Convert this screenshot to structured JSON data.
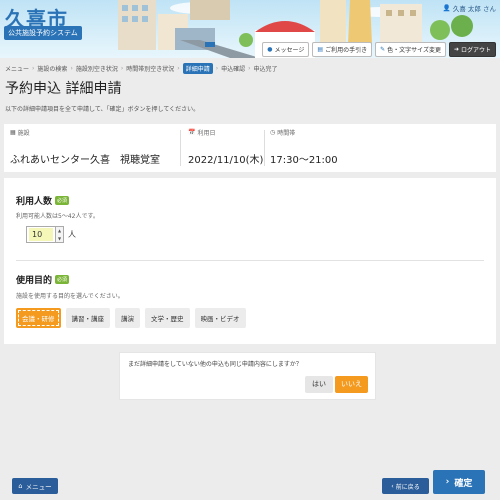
{
  "header": {
    "city": "久喜市",
    "system_name": "公共施設予約システム",
    "user": "久喜 太郎 さん",
    "toolbar": [
      {
        "label": "メッセージ",
        "icon": "speech-bubble-icon"
      },
      {
        "label": "ご利用の手引き",
        "icon": "document-icon"
      },
      {
        "label": "色・文字サイズ変更",
        "icon": "brush-icon"
      },
      {
        "label": "ログアウト",
        "icon": "logout-icon"
      }
    ]
  },
  "breadcrumb": [
    "メニュー",
    "施設の検索",
    "施設別空き状況",
    "時間帯別空き状況",
    "詳細申請",
    "申込確認",
    "申込完了"
  ],
  "page": {
    "title": "予約申込 詳細申請",
    "description": "以下の詳細申請項目を全て申請して、「確定」ボタンを押してください。"
  },
  "info": {
    "facility_label": "施設",
    "facility_value": "ふれあいセンター久喜　視聴覚室",
    "date_label": "利用日",
    "date_value": "2022/11/10(木)",
    "time_label": "時間帯",
    "time_value": "17:30～21:00"
  },
  "usage_count": {
    "title": "利用人数",
    "required": "必須",
    "description": "利用可能人数は5～42人です。",
    "value": "10",
    "unit": "人"
  },
  "purpose": {
    "title": "使用目的",
    "required": "必須",
    "description": "施設を使用する目的を選んでください。",
    "options": [
      "会議・研修",
      "講習・講座",
      "講演",
      "文学・歴史",
      "映画・ビデオ"
    ],
    "selected_index": 0
  },
  "confirm": {
    "text": "まだ詳細申請をしていない他の申込も同じ申請内容にしますか？",
    "yes": "はい",
    "no": "いいえ"
  },
  "footer": {
    "menu": "メニュー",
    "back": "前に戻る",
    "next": "確定"
  },
  "colors": {
    "primary": "#2a73b6",
    "accent": "#f39a1f",
    "required": "#7bb537"
  }
}
